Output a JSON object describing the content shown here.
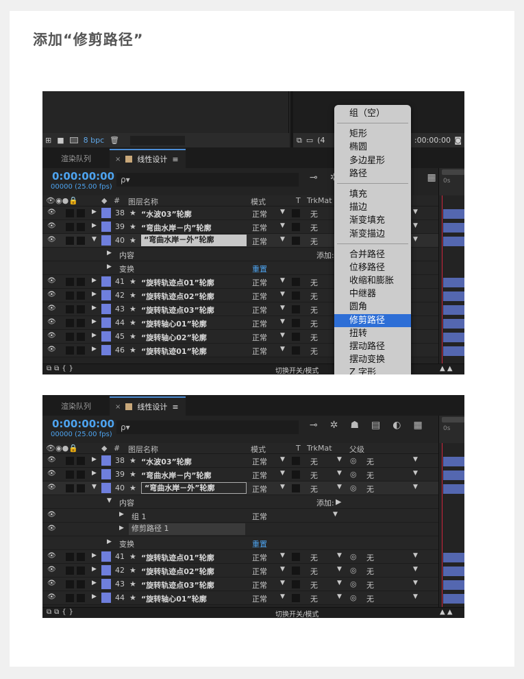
{
  "page_title": "添加“修剪路径”",
  "shot1": {
    "project_bar": {
      "bpc": "8 bpc"
    },
    "comp_bar": {
      "zoom": "(4",
      "timecode": ":00:00:00"
    },
    "tabs": {
      "render_queue": "渲染队列",
      "close": "×",
      "comp": "线性设计",
      "menu": "≡"
    },
    "timecode": "0:00:00:00",
    "fps": "00000 (25.00 fps)",
    "search_placeholder": "ρ▾",
    "ruler_label": "0s",
    "columns": {
      "hash": "#",
      "layer_name": "图层名称",
      "mode": "模式",
      "t": "T",
      "trkmat": "TrkMat"
    },
    "layers": [
      {
        "num": "38",
        "name": "“水波03”轮廓",
        "mode": "正常",
        "trk": "无"
      },
      {
        "num": "39",
        "name": "“弯曲水岸－内”轮廓",
        "mode": "正常",
        "trk": "无"
      },
      {
        "num": "40",
        "name": "“弯曲水岸－外”轮廓",
        "mode": "正常",
        "trk": "无"
      }
    ],
    "sub_contents": "内容",
    "add_label": "添加:",
    "sub_transform": "变换",
    "reset_label": "重置",
    "layers2": [
      {
        "num": "41",
        "name": "“旋转轨迹点01”轮廓",
        "mode": "正常",
        "trk": "无"
      },
      {
        "num": "42",
        "name": "“旋转轨迹点02”轮廓",
        "mode": "正常",
        "trk": "无"
      },
      {
        "num": "43",
        "name": "“旋转轨迹点03”轮廓",
        "mode": "正常",
        "trk": "无"
      },
      {
        "num": "44",
        "name": "“旋转轴心01”轮廓",
        "mode": "正常",
        "trk": "无"
      },
      {
        "num": "45",
        "name": "“旋转轴心02”轮廓",
        "mode": "正常",
        "trk": "无"
      },
      {
        "num": "46",
        "name": "“旋转轨迹01”轮廓",
        "mode": "正常",
        "trk": "无"
      }
    ],
    "footer": "切换开关/模式",
    "menu": {
      "g1": [
        "组（空）"
      ],
      "g2": [
        "矩形",
        "椭圆",
        "多边星形",
        "路径"
      ],
      "g3": [
        "填充",
        "描边",
        "渐变填充",
        "渐变描边"
      ],
      "g4": [
        "合并路径",
        "位移路径",
        "收缩和膨胀",
        "中继器",
        "圆角",
        "修剪路径",
        "扭转",
        "摆动路径",
        "摆动变换",
        "Z 字形"
      ],
      "selected": "修剪路径"
    }
  },
  "shot2": {
    "tabs": {
      "render_queue": "渲染队列",
      "close": "×",
      "comp": "线性设计",
      "menu": "≡"
    },
    "timecode": "0:00:00:00",
    "fps": "00000 (25.00 fps)",
    "search_placeholder": "ρ▾",
    "ruler_label": "0s",
    "columns": {
      "hash": "#",
      "layer_name": "图层名称",
      "mode": "模式",
      "t": "T",
      "trkmat": "TrkMat",
      "parent": "父级"
    },
    "layers": [
      {
        "num": "38",
        "name": "“水波03”轮廓",
        "mode": "正常",
        "trk": "无",
        "parent": "无"
      },
      {
        "num": "39",
        "name": "“弯曲水岸－内”轮廓",
        "mode": "正常",
        "trk": "无",
        "parent": "无"
      },
      {
        "num": "40",
        "name": "“弯曲水岸－外”轮廓",
        "mode": "正常",
        "trk": "无",
        "parent": "无"
      }
    ],
    "sub_contents": "内容",
    "add_label": "添加:",
    "group1": "组 1",
    "group1_mode": "正常",
    "trim_paths": "修剪路径 1",
    "sub_transform": "变换",
    "reset_label": "重置",
    "layers2": [
      {
        "num": "41",
        "name": "“旋转轨迹点01”轮廓",
        "mode": "正常",
        "trk": "无",
        "parent": "无"
      },
      {
        "num": "42",
        "name": "“旋转轨迹点02”轮廓",
        "mode": "正常",
        "trk": "无",
        "parent": "无"
      },
      {
        "num": "43",
        "name": "“旋转轨迹点03”轮廓",
        "mode": "正常",
        "trk": "无",
        "parent": "无"
      },
      {
        "num": "44",
        "name": "“旋转轴心01”轮廓",
        "mode": "正常",
        "trk": "无",
        "parent": "无"
      }
    ],
    "footer": "切换开关/模式"
  }
}
